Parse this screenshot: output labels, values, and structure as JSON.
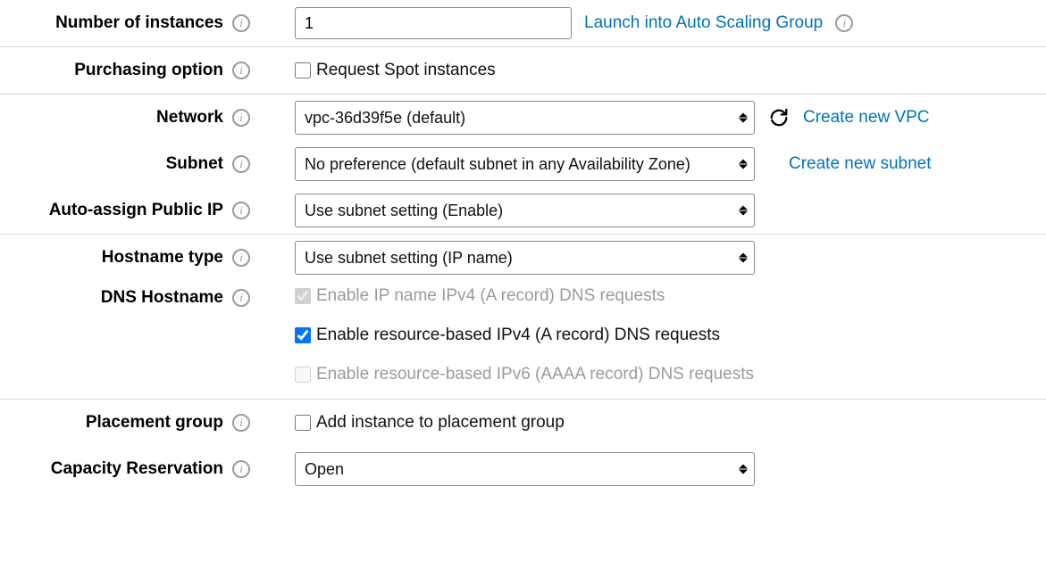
{
  "numberOfInstances": {
    "label": "Number of instances",
    "value": "1",
    "asgLink": "Launch into Auto Scaling Group"
  },
  "purchasingOption": {
    "label": "Purchasing option",
    "spotLabel": "Request Spot instances"
  },
  "network": {
    "label": "Network",
    "value": "vpc-36d39f5e (default)",
    "createLink": "Create new VPC"
  },
  "subnet": {
    "label": "Subnet",
    "value": "No preference (default subnet in any Availability Zone)",
    "createLink": "Create new subnet"
  },
  "autoAssignPublicIp": {
    "label": "Auto-assign Public IP",
    "value": "Use subnet setting (Enable)"
  },
  "hostnameType": {
    "label": "Hostname type",
    "value": "Use subnet setting (IP name)"
  },
  "dnsHostname": {
    "label": "DNS Hostname",
    "ipName": "Enable IP name IPv4 (A record) DNS requests",
    "resourceV4": "Enable resource-based IPv4 (A record) DNS requests",
    "resourceV6": "Enable resource-based IPv6 (AAAA record) DNS requests"
  },
  "placementGroup": {
    "label": "Placement group",
    "checkboxLabel": "Add instance to placement group"
  },
  "capacityReservation": {
    "label": "Capacity Reservation",
    "value": "Open"
  }
}
